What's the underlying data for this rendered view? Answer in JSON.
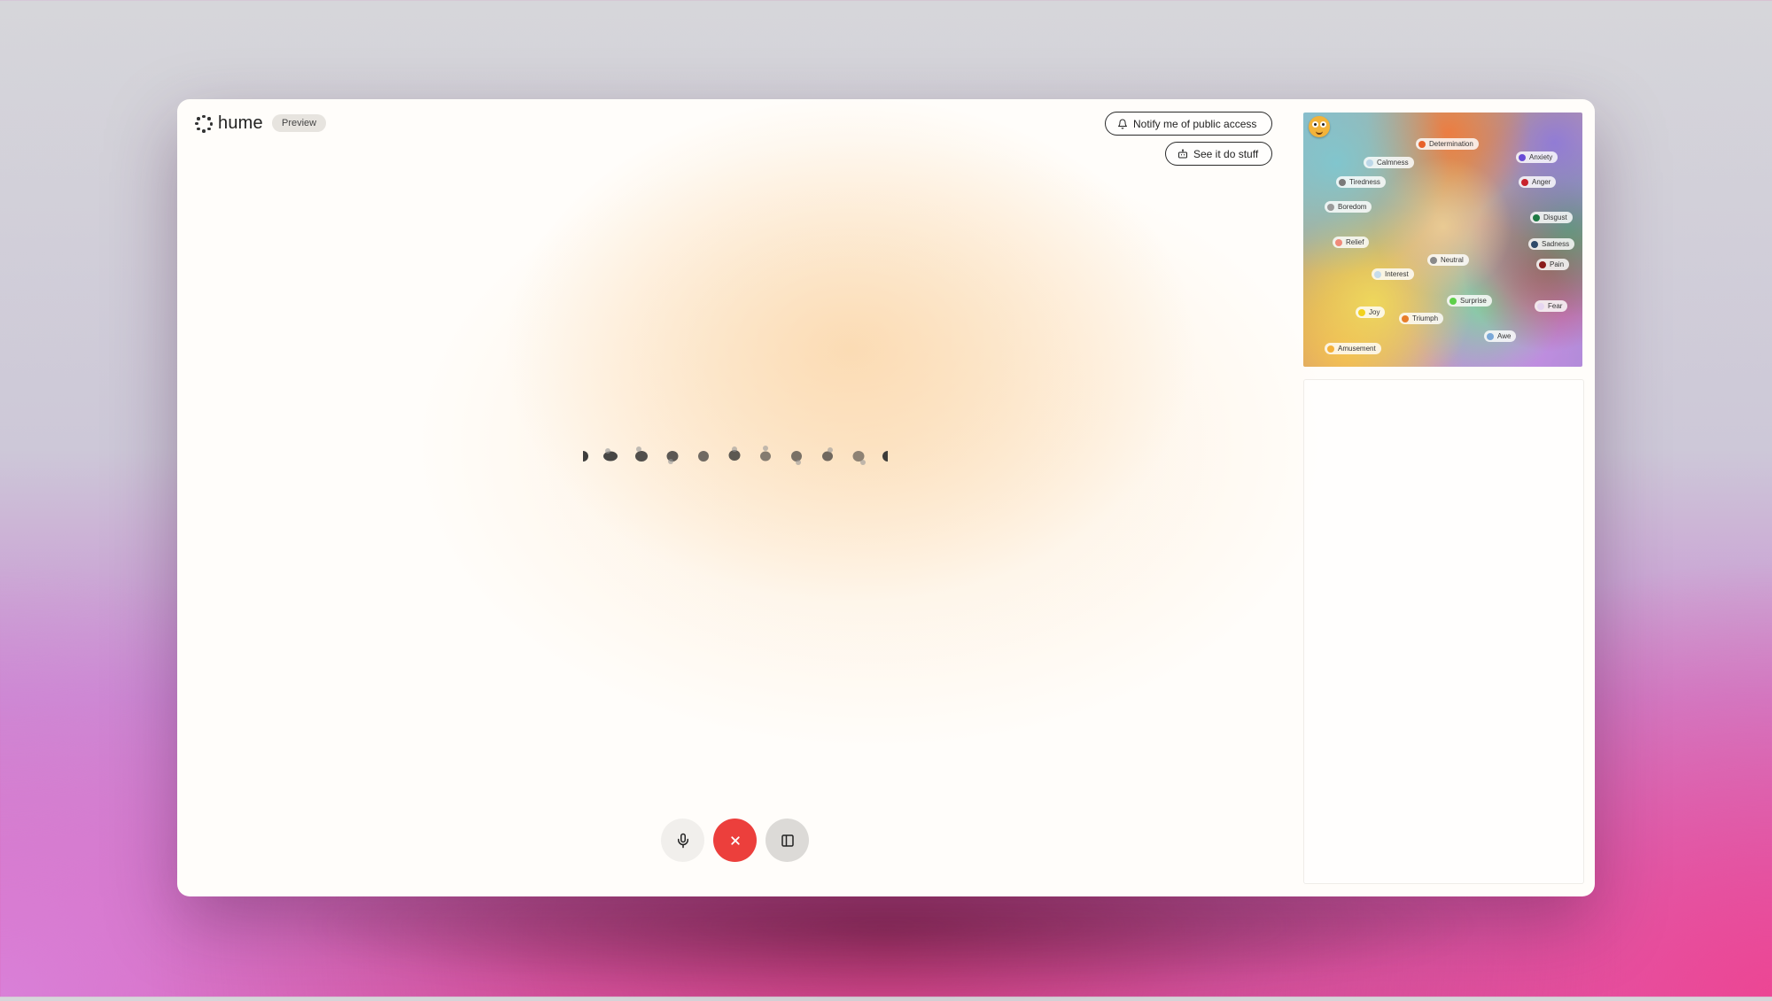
{
  "brand": {
    "name": "hume",
    "badge": "Preview"
  },
  "header": {
    "notify_label": "Notify me of public access",
    "stuff_label": "See it do stuff"
  },
  "controls": {
    "mic_icon": "mic-icon",
    "end_icon": "close-icon",
    "panel_icon": "panel-icon",
    "end_color": "#ec3f3c"
  },
  "emotions": [
    {
      "label": "Determination",
      "color": "#e8622a"
    },
    {
      "label": "Anxiety",
      "color": "#6a4bd6"
    },
    {
      "label": "Calmness",
      "color": "#bcd7e8"
    },
    {
      "label": "Tiredness",
      "color": "#7a7a7a"
    },
    {
      "label": "Anger",
      "color": "#c8232c"
    },
    {
      "label": "Boredom",
      "color": "#9a9a9a"
    },
    {
      "label": "Disgust",
      "color": "#1f7a45"
    },
    {
      "label": "Relief",
      "color": "#f08a7a"
    },
    {
      "label": "Sadness",
      "color": "#2f4a6a"
    },
    {
      "label": "Neutral",
      "color": "#8a8a8a"
    },
    {
      "label": "Pain",
      "color": "#8a1a1a"
    },
    {
      "label": "Interest",
      "color": "#c6dcec"
    },
    {
      "label": "Surprise",
      "color": "#5ed04a"
    },
    {
      "label": "Fear",
      "color": "#e6d6f0"
    },
    {
      "label": "Joy",
      "color": "#f2d21e"
    },
    {
      "label": "Triumph",
      "color": "#e87d2a"
    },
    {
      "label": "Awe",
      "color": "#7aa8d8"
    },
    {
      "label": "Amusement",
      "color": "#f5b23a"
    }
  ]
}
